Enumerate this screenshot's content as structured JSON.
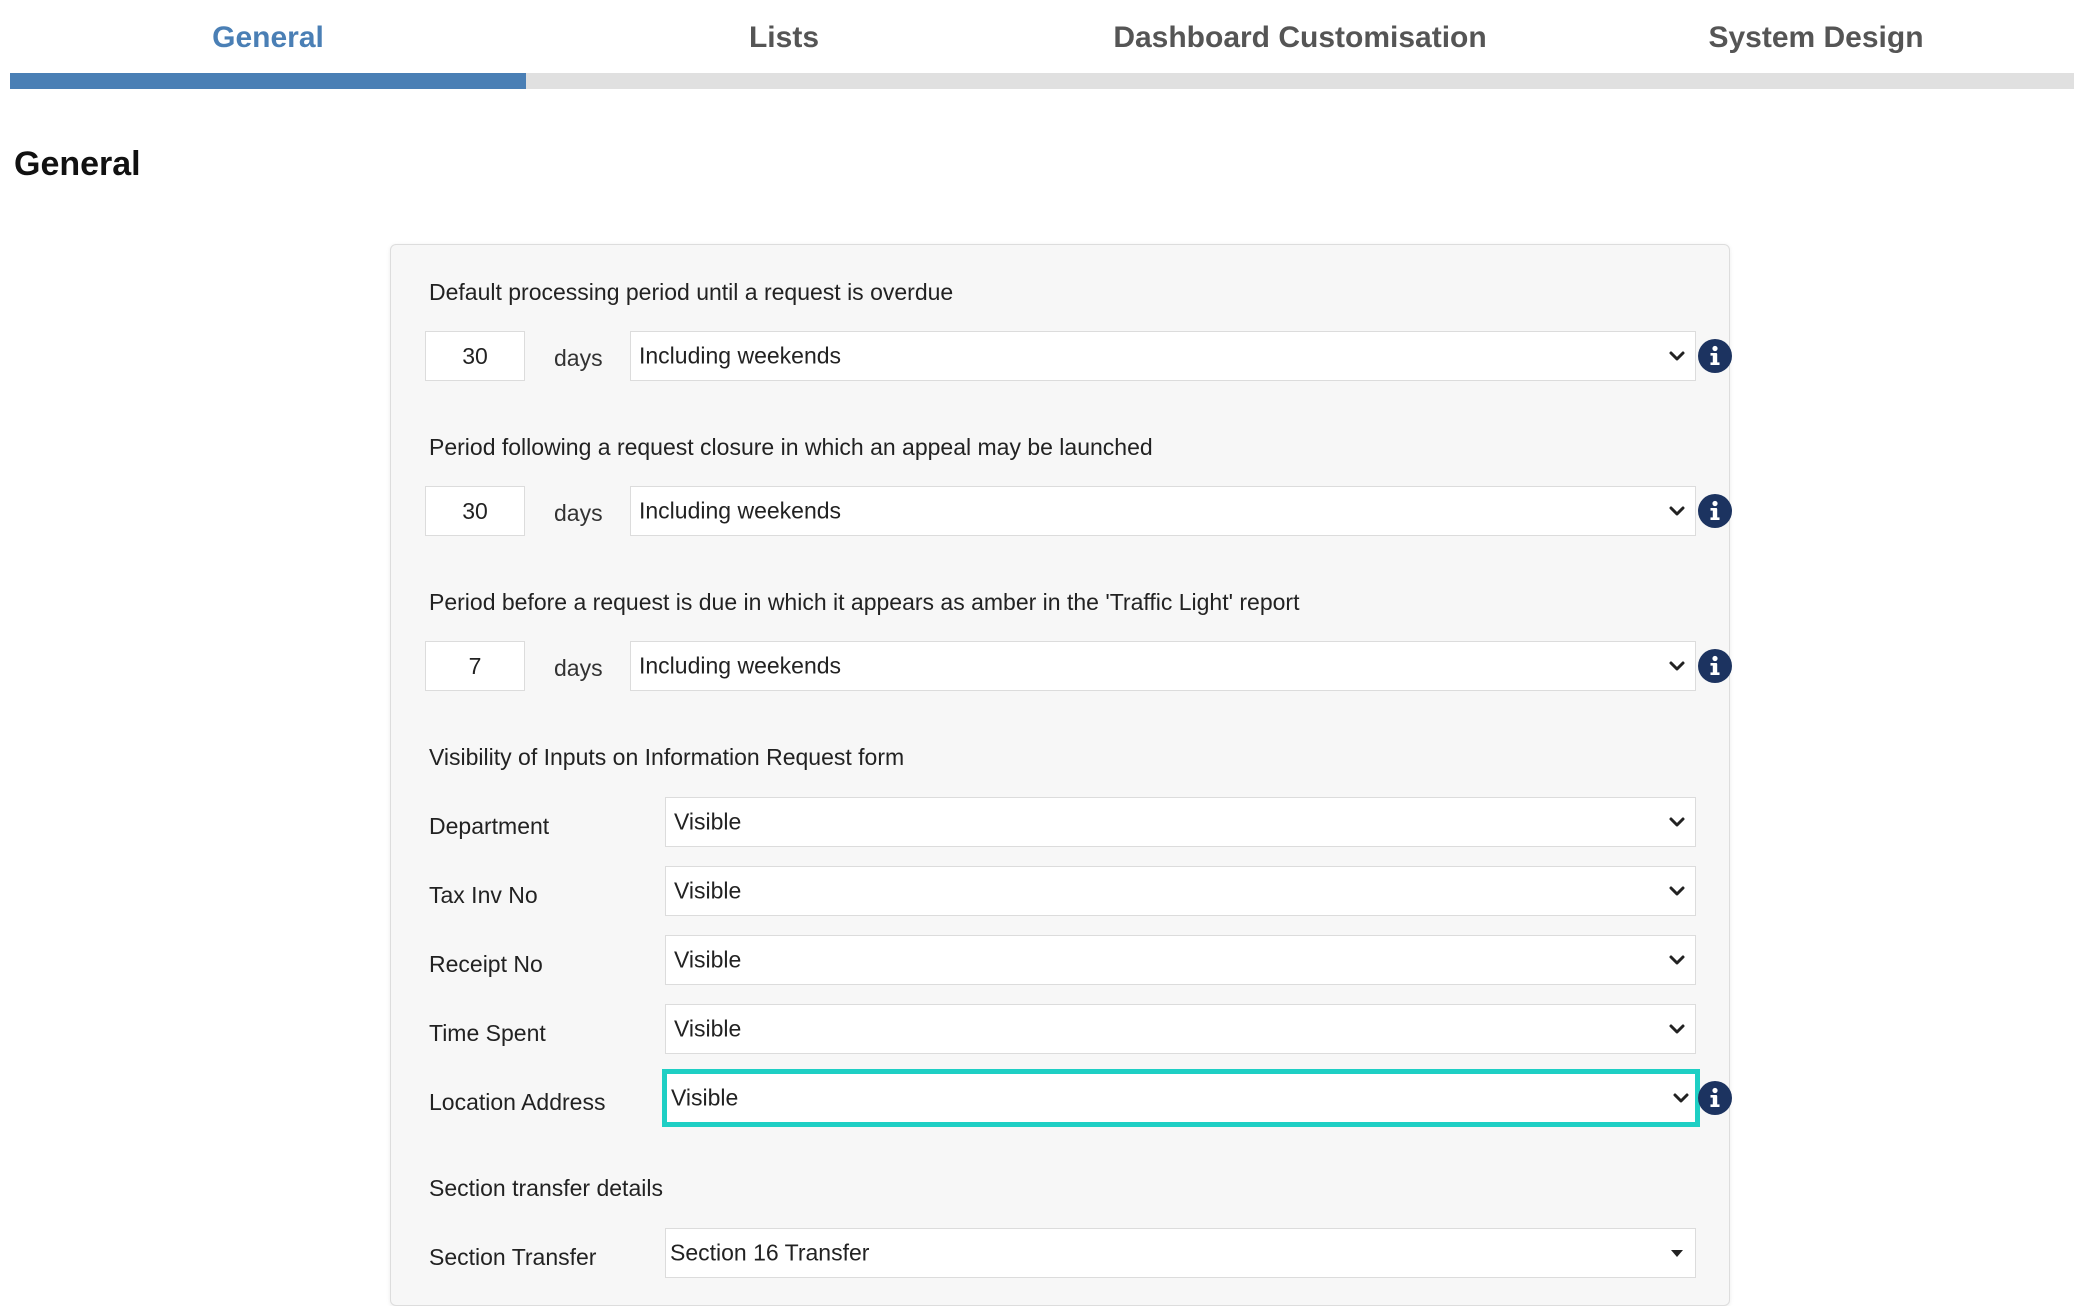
{
  "tabs": [
    {
      "label": "General",
      "active": true
    },
    {
      "label": "Lists",
      "active": false
    },
    {
      "label": "Dashboard Customisation",
      "active": false
    },
    {
      "label": "System Design",
      "active": false
    }
  ],
  "page_title": "General",
  "periods": [
    {
      "label": "Default processing period until a request is overdue",
      "value": "30",
      "unit": "days",
      "mode": "Including weekends"
    },
    {
      "label": "Period following a request closure in which an appeal may be launched",
      "value": "30",
      "unit": "days",
      "mode": "Including weekends"
    },
    {
      "label": "Period before a request is due in which it appears as amber in the 'Traffic Light' report",
      "value": "7",
      "unit": "days",
      "mode": "Including weekends"
    }
  ],
  "visibility": {
    "heading": "Visibility of Inputs on Information Request form",
    "fields": [
      {
        "label": "Department",
        "value": "Visible"
      },
      {
        "label": "Tax Inv No",
        "value": "Visible"
      },
      {
        "label": "Receipt No",
        "value": "Visible"
      },
      {
        "label": "Time Spent",
        "value": "Visible"
      },
      {
        "label": "Location Address",
        "value": "Visible",
        "focused": true
      }
    ]
  },
  "section_transfer": {
    "heading": "Section transfer details",
    "label": "Section Transfer",
    "value": "Section 16 Transfer"
  },
  "icons": {
    "info": "info-icon",
    "dropdown": "chevron-down-icon",
    "caret": "caret-down-icon"
  },
  "colors": {
    "accent": "#4a7fb5",
    "focus": "#1ecfc4",
    "info": "#1c3360"
  }
}
